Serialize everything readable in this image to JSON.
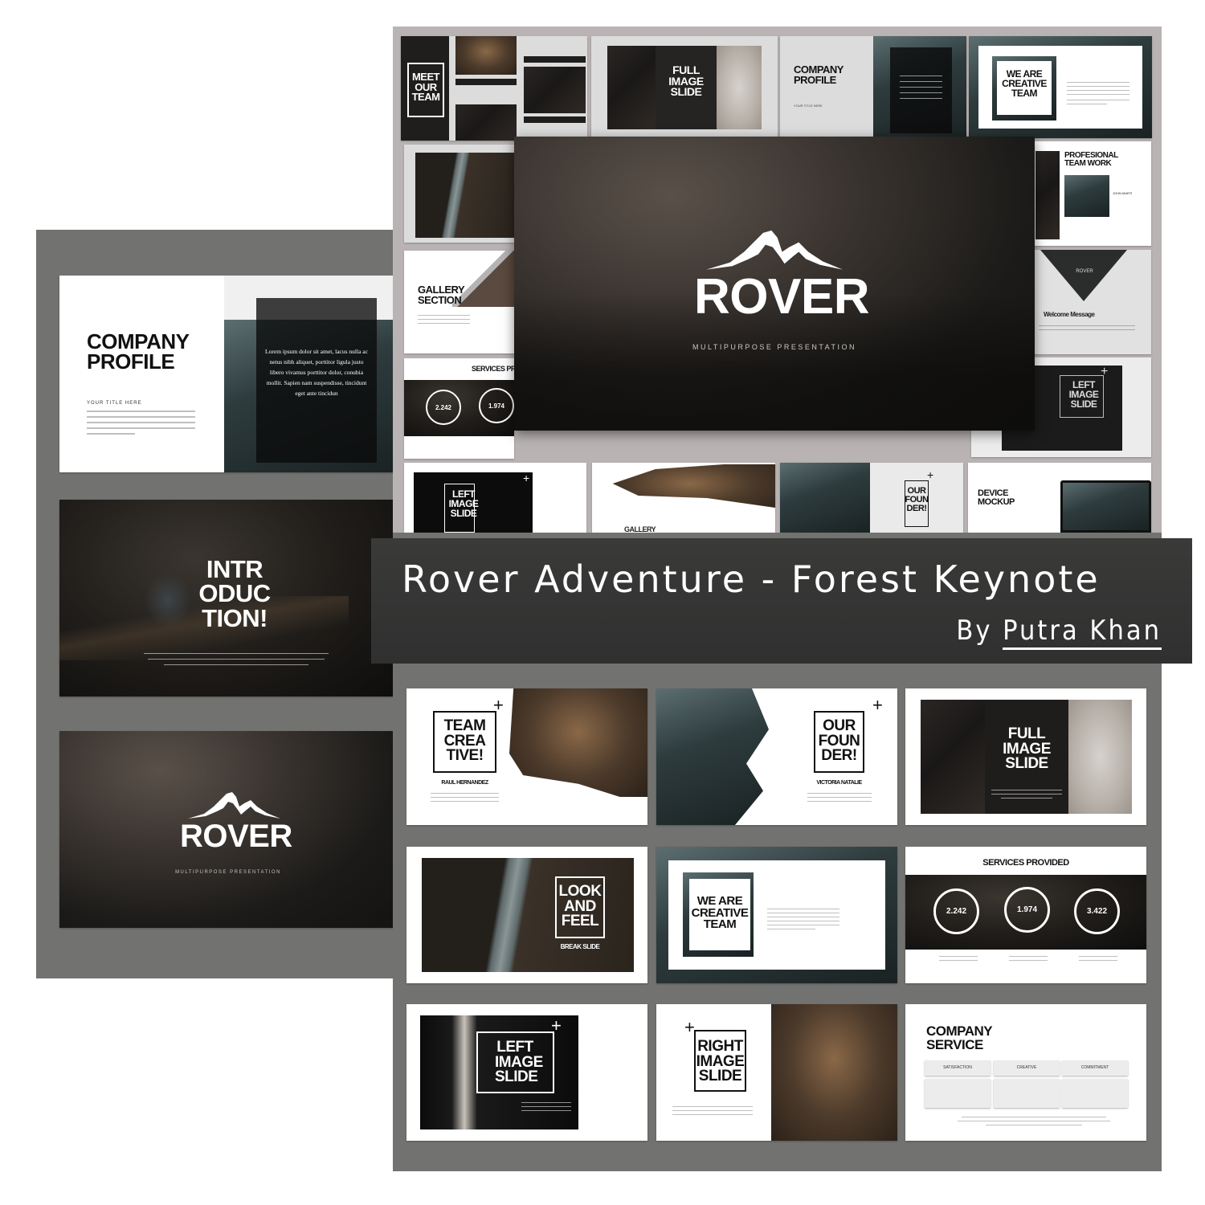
{
  "banner": {
    "title": "Rover Adventure - Forest Keynote",
    "by_label": "By",
    "author": "Putra Khan"
  },
  "colors": {
    "panel_dark_gray": "#727270",
    "panel_mauve_gray": "#b9b3b4",
    "banner_bg": "#333433",
    "text_white": "#ffffff",
    "text_black": "#111111"
  },
  "hero": {
    "brand": "ROVER",
    "subtitle": "MULTIPURPOSE PRESENTATION",
    "icon": "mountain-icon"
  },
  "top_collage": {
    "meet_team": {
      "title_lines": [
        "MEET",
        "OUR",
        "TEAM"
      ]
    },
    "full_image": {
      "title_lines": [
        "FULL",
        "IMAGE",
        "SLIDE"
      ]
    },
    "company_profile": {
      "title_lines": [
        "COMPANY",
        "PROFILE"
      ],
      "subheading": "YOUR TITLE HERE"
    },
    "creative_team": {
      "title_lines": [
        "WE ARE",
        "CREATIVE",
        "TEAM"
      ]
    },
    "professional_team": {
      "title_lines": [
        "PROFESIONAL",
        "TEAM WORK"
      ],
      "person": "JOHN MARTI"
    },
    "gallery_section": {
      "title_lines": [
        "GALLERY",
        "SECTION"
      ]
    },
    "services_partial": {
      "title": "SERVICES PROVID",
      "values": [
        "2.242",
        "1.974"
      ]
    },
    "welcome": {
      "brand": "ROVER",
      "heading": "Welcome Message"
    },
    "left_image_right": {
      "title_lines": [
        "LEFT",
        "IMAGE",
        "SLIDE"
      ]
    },
    "left_image_bottom": {
      "title_lines": [
        "LEFT",
        "IMAGE",
        "SLIDE"
      ]
    },
    "gallery_bottom": {
      "title": "GALLERY"
    },
    "our_founder": {
      "title_lines": [
        "OUR",
        "FOUN",
        "DER!"
      ]
    },
    "device_mockup": {
      "title_lines": [
        "DEVICE",
        "MOCKUP"
      ]
    }
  },
  "left_column": {
    "company_profile": {
      "title_lines": [
        "COMPANY",
        "PROFILE"
      ],
      "subheading": "YOUR TITLE HERE",
      "quote": "Lorem ipsum dolor sit amet, lacus nulla ac netus nibh aliquet, porttitor ligula justo libero vivamus porttitor dolor, conubia mollit. Sapien nam suspendisse, tincidunt eget ante tincidun"
    },
    "introduction": {
      "title_lines": [
        "INTR",
        "ODUC",
        "TION!"
      ]
    },
    "rover": {
      "brand": "ROVER",
      "subtitle": "MULTIPURPOSE PRESENTATION"
    }
  },
  "bottom_grid": {
    "team_creative": {
      "title_lines": [
        "TEAM",
        "CREA",
        "TIVE!"
      ],
      "person": "RAUL HERNANDEZ"
    },
    "our_founder": {
      "title_lines": [
        "OUR",
        "FOUN",
        "DER!"
      ],
      "person": "VICTORIA NATALIE"
    },
    "full_image": {
      "title_lines": [
        "FULL",
        "IMAGE",
        "SLIDE"
      ]
    },
    "look_and_feel": {
      "title_lines": [
        "LOOK",
        "AND",
        "FEEL"
      ],
      "caption": "BREAK SLIDE"
    },
    "creative_team": {
      "title_lines": [
        "WE ARE",
        "CREATIVE",
        "TEAM"
      ]
    },
    "services": {
      "title": "SERVICES PROVIDED",
      "values": [
        "2.242",
        "1.974",
        "3.422"
      ]
    },
    "left_image": {
      "title_lines": [
        "LEFT",
        "IMAGE",
        "SLIDE"
      ]
    },
    "right_image": {
      "title_lines": [
        "RIGHT",
        "IMAGE",
        "SLIDE"
      ]
    },
    "company_service": {
      "title_lines": [
        "COMPANY",
        "SERVICE"
      ],
      "columns": [
        "SATISFACTION",
        "CREATIVE",
        "COMMITMENT"
      ]
    }
  }
}
